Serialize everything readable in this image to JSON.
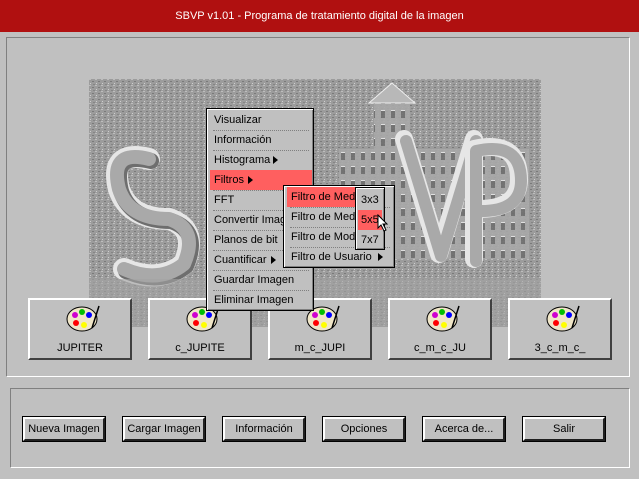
{
  "window": {
    "title": "SBVP v1.01 - Programa de tratamiento digital de la imagen"
  },
  "thumbnails": [
    {
      "label": "JUPITER",
      "icon": "palette-icon"
    },
    {
      "label": "c_JUPITE",
      "icon": "palette-icon"
    },
    {
      "label": "m_c_JUPI",
      "icon": "palette-icon"
    },
    {
      "label": "c_m_c_JU",
      "icon": "palette-icon"
    },
    {
      "label": "3_c_m_c_",
      "icon": "palette-icon"
    }
  ],
  "menu": {
    "items": [
      {
        "label": "Visualizar"
      },
      {
        "label": "Información"
      },
      {
        "label": "Histograma",
        "submenu": true
      },
      {
        "label": "Filtros",
        "submenu": true,
        "selected": true
      },
      {
        "label": "FFT"
      },
      {
        "label": "Convertir Imag"
      },
      {
        "label": "Planos de bit"
      },
      {
        "label": "Cuantificar",
        "submenu": true
      },
      {
        "label": "Guardar Imagen"
      },
      {
        "label": "Eliminar Imagen"
      }
    ]
  },
  "filtros_menu": {
    "items": [
      {
        "label": "Filtro de Med",
        "selected": true
      },
      {
        "label": "Filtro de Med"
      },
      {
        "label": "Filtro de Mod"
      },
      {
        "label": "Filtro de Usuario",
        "submenu": true
      }
    ]
  },
  "size_menu": {
    "items": [
      {
        "label": "3x3"
      },
      {
        "label": "5x5",
        "selected": true
      },
      {
        "label": "7x7"
      }
    ]
  },
  "buttons": [
    {
      "label": "Nueva Imagen"
    },
    {
      "label": "Cargar Imagen"
    },
    {
      "label": "Información"
    },
    {
      "label": "Opciones"
    },
    {
      "label": "Acerca de..."
    },
    {
      "label": "Salir"
    }
  ],
  "colors": {
    "titlebar": "#b01010",
    "selection": "#ff5f5f",
    "face": "#c0c0c0"
  }
}
